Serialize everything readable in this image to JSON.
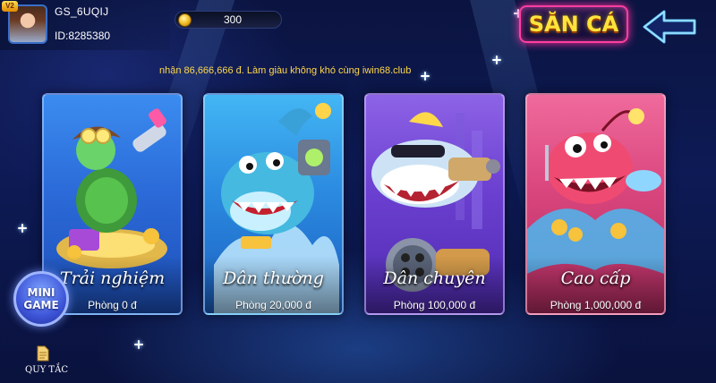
{
  "header": {
    "vip_label": "V2",
    "username": "GS_6UQIJ",
    "user_id": "ID:8285380",
    "coins": "300",
    "title": "SĂN CÁ",
    "back_icon": "arrow-left-icon"
  },
  "announcement": "nhận 86,666,666 đ. Làm giàu không khó cùng iwin68.club",
  "rooms": [
    {
      "name": "Trải nghiệm",
      "entry": "Phòng 0 đ",
      "theme": "#2b6ad8"
    },
    {
      "name": "Dân thường",
      "entry": "Phòng 20,000 đ",
      "theme": "#2b8ae0"
    },
    {
      "name": "Dân chuyên",
      "entry": "Phòng 100,000 đ",
      "theme": "#6b3fd0"
    },
    {
      "name": "Cao cấp",
      "entry": "Phòng 1,000,000 đ",
      "theme": "#d8457c"
    }
  ],
  "mini_game": {
    "label_line1": "MINI",
    "label_line2": "GAME"
  },
  "rules": {
    "label": "QUY TẮC",
    "icon": "document-icon"
  },
  "colors": {
    "title_text": "#ffe33a",
    "title_glow": "#ff3fa0",
    "announcement": "#ffd84a",
    "back_arrow": "#5fc8ff"
  }
}
